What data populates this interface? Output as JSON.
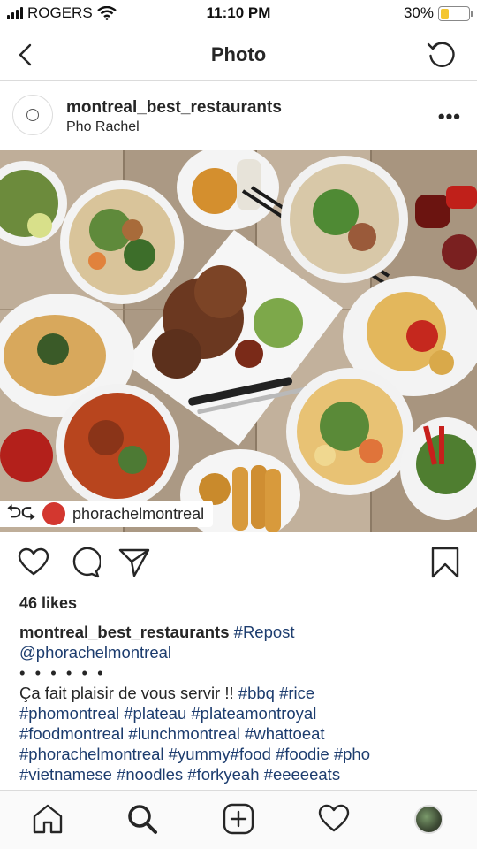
{
  "status_bar": {
    "carrier": "ROGERS",
    "time": "11:10 PM",
    "battery": "30%",
    "battery_level": 0.3
  },
  "header": {
    "title": "Photo",
    "back_icon": "chevron-left-icon",
    "refresh_icon": "refresh-icon"
  },
  "post": {
    "username": "montreal_best_restaurants",
    "location": "Pho Rachel",
    "more_icon": "more-horizontal-icon"
  },
  "photo": {
    "repost_icon": "repost-icon",
    "repost_username": "phorachelmontreal"
  },
  "actions": {
    "like_icon": "heart-icon",
    "comment_icon": "comment-icon",
    "share_icon": "send-icon",
    "save_icon": "bookmark-icon"
  },
  "likes": "46 likes",
  "caption": {
    "username": "montreal_best_restaurants",
    "tag_repost": "#Repost",
    "mention": "@phorachelmontreal",
    "dots": "• • • • • •",
    "text": "Ça fait plaisir de vous servir !! ",
    "hashtags_line1": "#bbq #rice",
    "hashtags_line2": "#phomontreal #plateau #plateamontroyal",
    "hashtags_line3": "#foodmontreal #lunchmontreal #whattoeat",
    "hashtags_line4a": "#phorachelmontreal #yummy#food #foodie #pho",
    "hashtags_line5": "#vietnamese #noodles #forkyeah #eeeeeats"
  },
  "tab_bar": {
    "home_icon": "home-icon",
    "search_icon": "search-icon",
    "add_icon": "add-post-icon",
    "activity_icon": "heart-icon",
    "profile_icon": "profile-avatar"
  }
}
